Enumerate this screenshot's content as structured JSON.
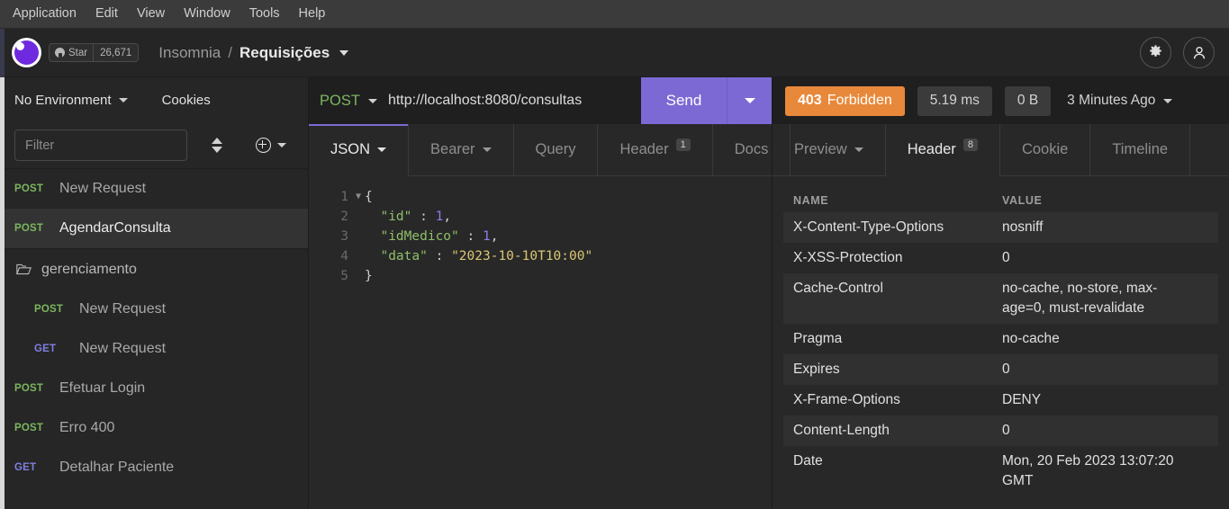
{
  "menubar": {
    "items": [
      "Application",
      "Edit",
      "View",
      "Window",
      "Tools",
      "Help"
    ]
  },
  "titlebar": {
    "logo_icon": "insomnia-moon-logo",
    "github_star_label": "Star",
    "github_star_count": "26,671",
    "workspace": "Insomnia",
    "separator": "/",
    "current": "Requisições",
    "settings_icon": "gear-icon",
    "account_icon": "account-icon"
  },
  "sidebar": {
    "environment_label": "No Environment",
    "cookies_label": "Cookies",
    "filter_placeholder": "Filter",
    "filter_value": "",
    "sort_icon": "sort-icon",
    "add_icon": "plus-circle-icon",
    "items": [
      {
        "type": "request",
        "method": "POST",
        "name": "New Request",
        "active": false,
        "nested": false
      },
      {
        "type": "request",
        "method": "POST",
        "name": "AgendarConsulta",
        "active": true,
        "nested": false
      },
      {
        "type": "folder",
        "method": "",
        "name": "gerenciamento",
        "active": false,
        "nested": false
      },
      {
        "type": "request",
        "method": "POST",
        "name": "New Request",
        "active": false,
        "nested": true
      },
      {
        "type": "request",
        "method": "GET",
        "name": "New Request",
        "active": false,
        "nested": true
      },
      {
        "type": "request",
        "method": "POST",
        "name": "Efetuar Login",
        "active": false,
        "nested": false
      },
      {
        "type": "request",
        "method": "POST",
        "name": "Erro 400",
        "active": false,
        "nested": false
      },
      {
        "type": "request",
        "method": "GET",
        "name": "Detalhar Paciente",
        "active": false,
        "nested": false
      }
    ]
  },
  "request": {
    "method": "POST",
    "url": "http://localhost:8080/consultas",
    "send_label": "Send",
    "tabs": [
      {
        "label": "JSON",
        "active": true,
        "caret": true,
        "badge": ""
      },
      {
        "label": "Bearer",
        "active": false,
        "caret": true,
        "badge": ""
      },
      {
        "label": "Query",
        "active": false,
        "caret": false,
        "badge": ""
      },
      {
        "label": "Header",
        "active": false,
        "caret": false,
        "badge": "1"
      },
      {
        "label": "Docs",
        "active": false,
        "caret": false,
        "badge": ""
      }
    ],
    "body_lines": [
      {
        "num": "1",
        "fold": "▼",
        "tokens": [
          {
            "t": "pun",
            "v": "{"
          }
        ]
      },
      {
        "num": "2",
        "fold": "",
        "tokens": [
          {
            "t": "pun",
            "v": "  "
          },
          {
            "t": "key",
            "v": "\"id\""
          },
          {
            "t": "pun",
            "v": " : "
          },
          {
            "t": "num",
            "v": "1"
          },
          {
            "t": "pun",
            "v": ","
          }
        ]
      },
      {
        "num": "3",
        "fold": "",
        "tokens": [
          {
            "t": "pun",
            "v": "  "
          },
          {
            "t": "key",
            "v": "\"idMedico\""
          },
          {
            "t": "pun",
            "v": " : "
          },
          {
            "t": "num",
            "v": "1"
          },
          {
            "t": "pun",
            "v": ","
          }
        ]
      },
      {
        "num": "4",
        "fold": "",
        "tokens": [
          {
            "t": "pun",
            "v": "  "
          },
          {
            "t": "key",
            "v": "\"data\""
          },
          {
            "t": "pun",
            "v": " : "
          },
          {
            "t": "str",
            "v": "\"2023-10-10T10:00\""
          }
        ]
      },
      {
        "num": "5",
        "fold": "",
        "tokens": [
          {
            "t": "pun",
            "v": "}"
          }
        ]
      }
    ]
  },
  "response": {
    "status_code": "403",
    "status_text": "Forbidden",
    "status_color": "#e8883a",
    "time": "5.19 ms",
    "size": "0 B",
    "timestamp": "3 Minutes Ago",
    "tabs": [
      {
        "label": "Preview",
        "active": false,
        "caret": true,
        "badge": ""
      },
      {
        "label": "Header",
        "active": true,
        "caret": false,
        "badge": "8"
      },
      {
        "label": "Cookie",
        "active": false,
        "caret": false,
        "badge": ""
      },
      {
        "label": "Timeline",
        "active": false,
        "caret": false,
        "badge": ""
      }
    ],
    "headers_table": {
      "columns": [
        "NAME",
        "VALUE"
      ],
      "rows": [
        {
          "name": "X-Content-Type-Options",
          "value": "nosniff"
        },
        {
          "name": "X-XSS-Protection",
          "value": "0"
        },
        {
          "name": "Cache-Control",
          "value": "no-cache, no-store, max-age=0, must-revalidate"
        },
        {
          "name": "Pragma",
          "value": "no-cache"
        },
        {
          "name": "Expires",
          "value": "0"
        },
        {
          "name": "X-Frame-Options",
          "value": "DENY"
        },
        {
          "name": "Content-Length",
          "value": "0"
        },
        {
          "name": "Date",
          "value": "Mon, 20 Feb 2023 13:07:20 GMT"
        }
      ]
    }
  }
}
